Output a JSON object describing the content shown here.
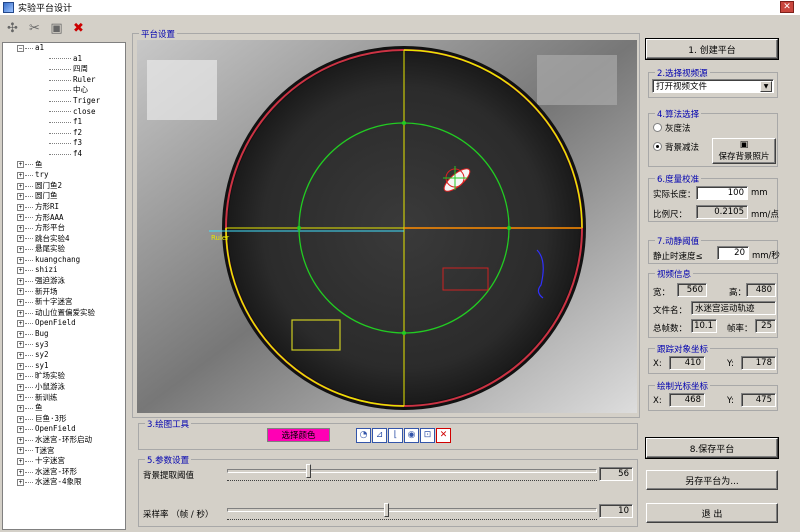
{
  "window": {
    "title": "实验平台设计",
    "close_label": "✕"
  },
  "toolbar": {
    "icons": [
      "arrows-icon",
      "tools-icon",
      "palette-icon",
      "color-cross-icon"
    ]
  },
  "tree": {
    "items": [
      {
        "label": "a1",
        "kind": "group",
        "sign": "−"
      },
      {
        "label": "a1",
        "kind": "leaf"
      },
      {
        "label": "四周",
        "kind": "leaf"
      },
      {
        "label": "Ruler",
        "kind": "leaf"
      },
      {
        "label": "中心",
        "kind": "leaf"
      },
      {
        "label": "Triger",
        "kind": "leaf"
      },
      {
        "label": "close",
        "kind": "leaf"
      },
      {
        "label": "f1",
        "kind": "leaf"
      },
      {
        "label": "f2",
        "kind": "leaf"
      },
      {
        "label": "f3",
        "kind": "leaf"
      },
      {
        "label": "f4",
        "kind": "leaf"
      },
      {
        "label": "鱼",
        "kind": "group",
        "sign": "+"
      },
      {
        "label": "try",
        "kind": "group",
        "sign": "+"
      },
      {
        "label": "圆门鱼2",
        "kind": "group",
        "sign": "+"
      },
      {
        "label": "圆门鱼",
        "kind": "group",
        "sign": "+"
      },
      {
        "label": "方形RI",
        "kind": "group",
        "sign": "+"
      },
      {
        "label": "方形AAA",
        "kind": "group",
        "sign": "+"
      },
      {
        "label": "方形平台",
        "kind": "group",
        "sign": "+"
      },
      {
        "label": "跳台实验4",
        "kind": "group",
        "sign": "+"
      },
      {
        "label": "悬尾实验",
        "kind": "group",
        "sign": "+"
      },
      {
        "label": "kuangchang",
        "kind": "group",
        "sign": "+"
      },
      {
        "label": "shizi",
        "kind": "group",
        "sign": "+"
      },
      {
        "label": "强迫游泳",
        "kind": "group",
        "sign": "+"
      },
      {
        "label": "新开场",
        "kind": "group",
        "sign": "+"
      },
      {
        "label": "新十字迷宫",
        "kind": "group",
        "sign": "+"
      },
      {
        "label": "动山位置偏爱实验",
        "kind": "group",
        "sign": "+"
      },
      {
        "label": "OpenField",
        "kind": "group",
        "sign": "+"
      },
      {
        "label": "Bug",
        "kind": "group",
        "sign": "+"
      },
      {
        "label": "sy3",
        "kind": "group",
        "sign": "+"
      },
      {
        "label": "sy2",
        "kind": "group",
        "sign": "+"
      },
      {
        "label": "sy1",
        "kind": "group",
        "sign": "+"
      },
      {
        "label": "旷场实验",
        "kind": "group",
        "sign": "+"
      },
      {
        "label": "小鼠游泳",
        "kind": "group",
        "sign": "+"
      },
      {
        "label": "新训练",
        "kind": "group",
        "sign": "+"
      },
      {
        "label": "鱼",
        "kind": "group",
        "sign": "+"
      },
      {
        "label": "巨鱼·3形",
        "kind": "group",
        "sign": "+"
      },
      {
        "label": "OpenField",
        "kind": "group",
        "sign": "+"
      },
      {
        "label": "水迷宫-环形启动",
        "kind": "group",
        "sign": "+"
      },
      {
        "label": "T迷宫",
        "kind": "group",
        "sign": "+"
      },
      {
        "label": "十字迷宫",
        "kind": "group",
        "sign": "+"
      },
      {
        "label": "水迷宫-环形",
        "kind": "group",
        "sign": "+"
      },
      {
        "label": "水迷宫-4象限",
        "kind": "group",
        "sign": "+"
      }
    ]
  },
  "platform_group": {
    "label": "平台设置",
    "ruler_text": "Ruler"
  },
  "draw_tools": {
    "label": "3.绘图工具",
    "select_color_label": "选择颜色",
    "tools": [
      "◔",
      "⊿",
      "⌊",
      "◉",
      "⊡",
      "✕"
    ]
  },
  "params": {
    "label": "5.参数设置",
    "bg_threshold_label": "背景提取阈值",
    "bg_threshold_value": "56",
    "bg_threshold_fraction": 0.22,
    "sample_rate_label": "采样率 （帧 / 秒）",
    "sample_rate_value": "10",
    "sample_rate_fraction": 0.43
  },
  "right": {
    "create_button": "1. 创建平台",
    "source_label": "2.选择视频源",
    "source_value": "打开视频文件",
    "algo_label": "4.算法选择",
    "algo_gray": "灰度法",
    "algo_bg": "背景减法",
    "update_bg_button": "保存背景照片",
    "calib_label": "6.度量校准",
    "real_length_label": "实际长度：",
    "real_length_value": "100",
    "real_length_unit": "mm",
    "scale_label": "比例尺：",
    "scale_value": "0.2105",
    "scale_unit": "mm/点",
    "motion_label": "7.动静阈值",
    "still_speed_label": "静止时速度≤",
    "still_speed_value": "20",
    "still_speed_unit": "mm/秒",
    "video_info_label": "视频信息",
    "width_label": "宽：",
    "width_value": "560",
    "height_label": "高：",
    "height_value": "480",
    "file_label": "文件名：",
    "file_value": "水迷宫运动轨迹",
    "frames_label": "总帧数：",
    "frames_value": "10.1",
    "fps_label": "帧率：",
    "fps_value": "25",
    "tracked_label": "跟踪对象坐标",
    "tracked_x_label": "X:",
    "tracked_x": "410",
    "tracked_y_label": "Y:",
    "tracked_y": "178",
    "cursor_label": "绘制光标坐标",
    "cursor_x_label": "X:",
    "cursor_x": "468",
    "cursor_y_label": "Y:",
    "cursor_y": "475",
    "save_button": "8.保存平台",
    "save_as_button": "另存平台为...",
    "exit_button": "退 出"
  },
  "colors": {
    "group_label": "#0000b0",
    "outer_circle": "#cc3344",
    "quadrant": "#e6e600",
    "inner_circle": "#22cc22",
    "ruler": "#ff8c00",
    "select_color": "#ff00b4"
  }
}
